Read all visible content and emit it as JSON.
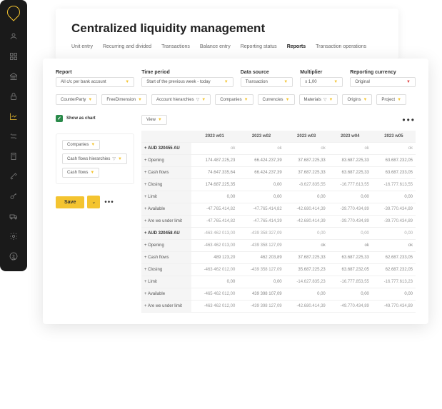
{
  "sidebar": {
    "icons": [
      "user",
      "grid",
      "bank",
      "lock",
      "chart",
      "transfer",
      "building",
      "tools",
      "key",
      "truck",
      "gear",
      "help"
    ],
    "active_index": 4
  },
  "header": {
    "title": "Centralized liquidity management",
    "tabs": [
      "Unit entry",
      "Recurring and divided",
      "Transactions",
      "Balance entry",
      "Reporting status",
      "Reports",
      "Transaction operations"
    ],
    "active_tab": 5
  },
  "filters": {
    "report": {
      "label": "Report",
      "value": "All c/c per bank account"
    },
    "time_period": {
      "label": "Time period",
      "value": "Start of the previous week - today"
    },
    "data_source": {
      "label": "Data source",
      "value": "Transaction"
    },
    "multiplier": {
      "label": "Multiplier",
      "value": "x 1,00"
    },
    "reporting_currency": {
      "label": "Reporting currency",
      "value": "Original"
    }
  },
  "chips": [
    "CounterParty",
    "FreeDimension",
    "Account hierarchies",
    "Companies",
    "Currencies",
    "Materials",
    "Origins",
    "Project"
  ],
  "left": {
    "show_as_chart": "Show as chart",
    "panel_chips": [
      "Companies",
      "Cash flows hierarchies",
      "Cash flows"
    ],
    "save": "Save"
  },
  "table": {
    "view_chip": "View",
    "columns": [
      "",
      "2023 w01",
      "2023 w02",
      "2023 w03",
      "2023 w04",
      "2023 w05"
    ],
    "rows": [
      {
        "label": "+ AUD 320455 AU",
        "group": true,
        "vals": [
          "ok",
          "ok",
          "ok",
          "ok",
          "ok"
        ]
      },
      {
        "label": "+ Opening",
        "vals": [
          "174.487.225,23",
          "66.424.237,39",
          "37.687.225,33",
          "83.687.225,33",
          "63.687.232,05"
        ]
      },
      {
        "label": "+ Cash flows",
        "vals": [
          "74.647.335,64",
          "66.424.237,39",
          "37.687.225,33",
          "63.687.225,33",
          "63.687.233,05"
        ]
      },
      {
        "label": "+ Closing",
        "vals": [
          "174.687.225,35",
          "0,00",
          "-8.627.835,55",
          "-16.777.613,55",
          "-16.777.613,55"
        ]
      },
      {
        "label": "+ Limit",
        "vals": [
          "0,00",
          "0,00",
          "0,00",
          "0,00",
          "0,00"
        ]
      },
      {
        "label": "+ Available",
        "vals": [
          "-47.765.414,82",
          "-47.765.414,82",
          "-42.680.414,39",
          "-39.770.434,89",
          "-39.770.434,89"
        ]
      },
      {
        "label": "+ Are we under limit",
        "vals": [
          "-47.765.414,82",
          "-47.765.414,39",
          "-42.680.414,39",
          "-39.770.434,89",
          "-39.770.434,89"
        ]
      },
      {
        "label": "+ AUD 320458 AU",
        "group": true,
        "vals": [
          "-463 462 013,00",
          "-439 358 327,09",
          "0,00",
          "0,00",
          "0,00"
        ]
      },
      {
        "label": "+ Opening",
        "vals": [
          "-463 462 013,00",
          "-439 358 127,09",
          "ok",
          "ok",
          "ok"
        ]
      },
      {
        "label": "+ Cash flows",
        "vals": [
          "489 123,20",
          "462 203,89",
          "37.687.225,33",
          "63.687.225,33",
          "62.687.233,05"
        ]
      },
      {
        "label": "+ Closing",
        "vals": [
          "-463 462 012,00",
          "-439 358 127,09",
          "35.687.225,23",
          "63.687.232,05",
          "62.687.232,05"
        ]
      },
      {
        "label": "+ Limit",
        "vals": [
          "0,00",
          "0,00",
          "-14.627.835,23",
          "-16.777.853,55",
          "-16.777.613,23"
        ]
      },
      {
        "label": "+ Available",
        "vals": [
          "-465 462 012,00",
          "439 398 107,09",
          "0,00",
          "0,00",
          "0,00"
        ]
      },
      {
        "label": "+ Are we under limit",
        "vals": [
          "-463 462 012,00",
          "-439 398 127,09",
          "-42.680.414,39",
          "-49.770.434,89",
          "-49.770.434,89"
        ]
      }
    ]
  }
}
